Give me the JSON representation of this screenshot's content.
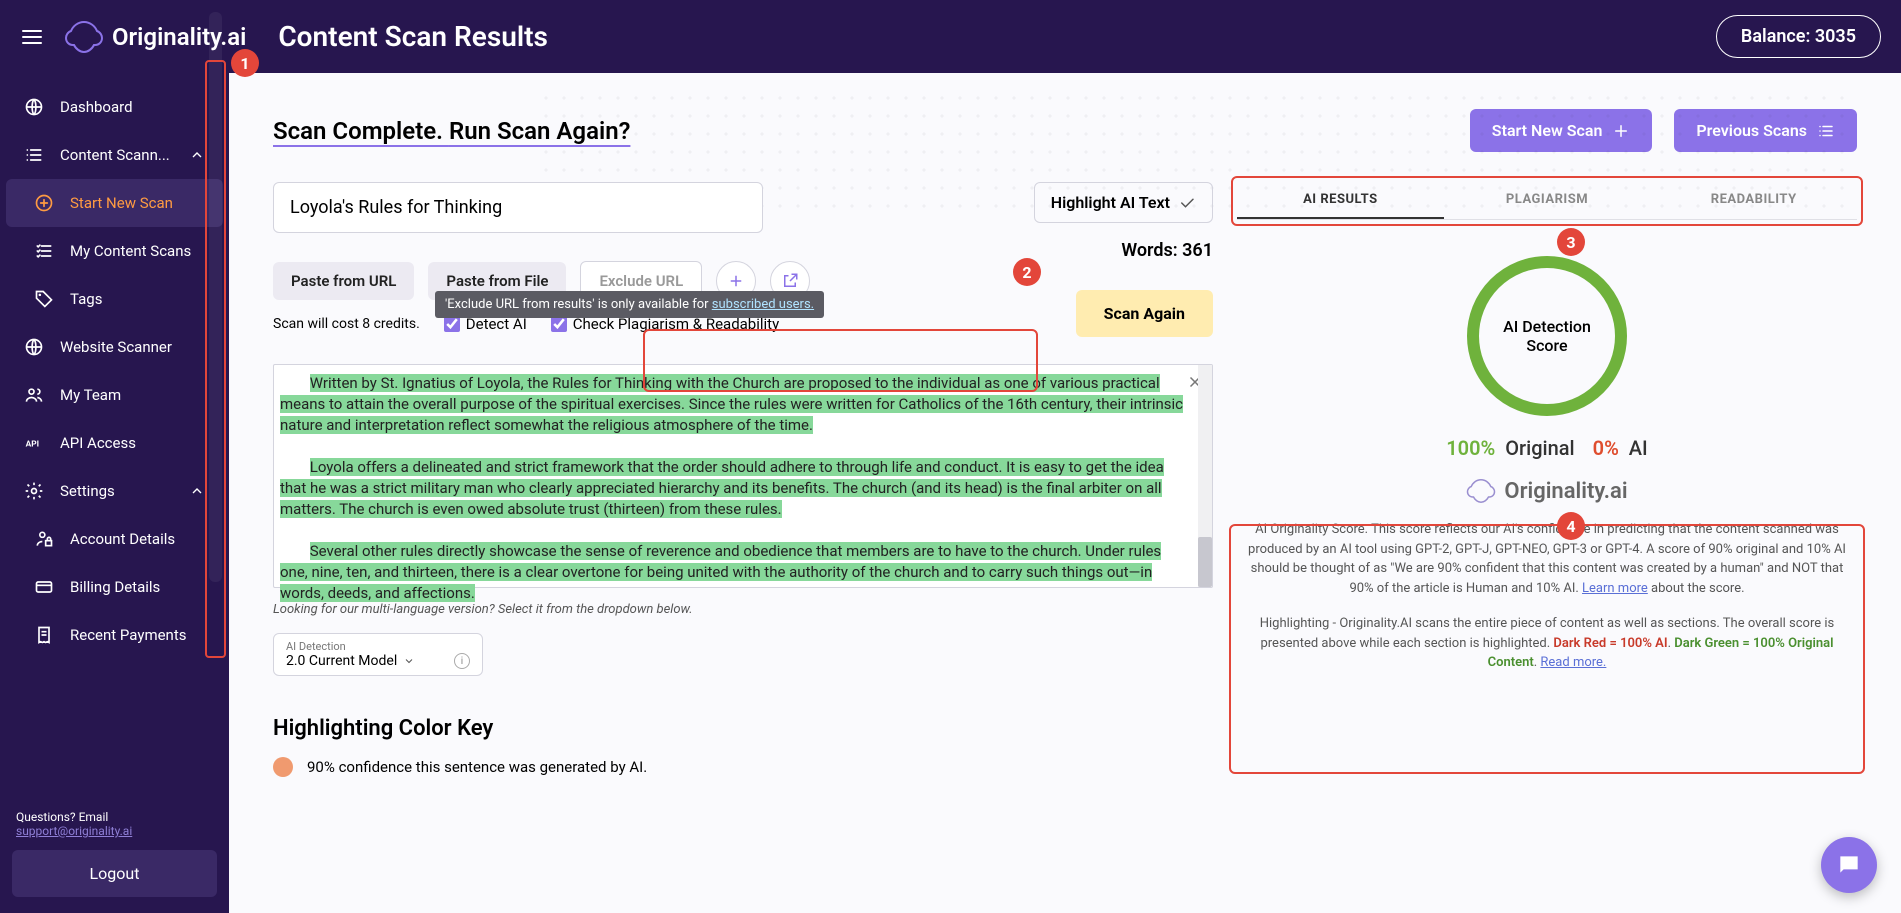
{
  "header": {
    "logo_text": "Originality.ai",
    "page_title": "Content Scan Results",
    "balance_label": "Balance: 3035"
  },
  "sidebar": {
    "items": [
      {
        "label": "Dashboard",
        "icon": "globe"
      },
      {
        "label": "Content Scann...",
        "icon": "list",
        "chevron": true
      },
      {
        "label": "Start New Scan",
        "icon": "plus-circle",
        "indented": true,
        "active": true
      },
      {
        "label": "My Content Scans",
        "icon": "list-check",
        "indented": true
      },
      {
        "label": "Tags",
        "icon": "tag",
        "indented": true
      },
      {
        "label": "Website Scanner",
        "icon": "globe"
      },
      {
        "label": "My Team",
        "icon": "users"
      },
      {
        "label": "API Access",
        "icon": "api"
      },
      {
        "label": "Settings",
        "icon": "gear",
        "chevron": true
      },
      {
        "label": "Account Details",
        "icon": "user-lock",
        "indented": true
      },
      {
        "label": "Billing Details",
        "icon": "card",
        "indented": true
      },
      {
        "label": "Recent Payments",
        "icon": "receipt",
        "indented": true
      }
    ],
    "questions_prefix": "Questions? Email ",
    "support_email": "support@originality.ai",
    "logout": "Logout"
  },
  "main": {
    "scan_complete": "Scan Complete. ",
    "run_again": "Run Scan Again?",
    "start_new_scan": "Start New Scan",
    "previous_scans": "Previous Scans",
    "title_value": "Loyola's Rules for Thinking",
    "paste_url": "Paste from URL",
    "paste_file": "Paste from File",
    "exclude_url": "Exclude URL",
    "cost_text": "Scan will cost 8 credits.",
    "detect_ai": "Detect AI",
    "check_plag": "Check Plagiarism & Readability",
    "tooltip_prefix": "'Exclude URL from results' is only available for ",
    "tooltip_link": "subscribed users.",
    "highlight_toggle": "Highlight AI Text",
    "words": "Words: 361",
    "scan_again": "Scan Again",
    "editor_p1": "Written by St. Ignatius of Loyola, the Rules for Thinking with the Church are proposed to the individual as one of various practical means to attain the overall purpose of the spiritual exercises. Since the rules were written for Catholics of the 16th century, their intrinsic nature and interpretation reflect somewhat the religious atmosphere of the time.",
    "editor_p2": "Loyola offers a delineated and strict framework that the order should adhere to through life and conduct. It is easy to get the idea that he was a strict military man who clearly appreciated hierarchy and its benefits. The church (and its head) is the final arbiter on all matters. The church is even owed absolute trust (thirteen) from these rules.",
    "editor_p3": "Several other rules directly showcase the sense of reverence and obedience that members are to have to the church. Under rules one, nine, ten, and thirteen, there is a clear overtone for being united with the authority of the church and to carry such things out—in words, deeds, and affections.",
    "hint_text": "Looking for our multi-language version? Select it from the dropdown below.",
    "model_label": "AI Detection",
    "model_value": "2.0 Current Model",
    "color_key_title": "Highlighting Color Key",
    "color_key_items": [
      {
        "color": "#f09a6f",
        "text": "90% confidence this sentence was generated by AI."
      }
    ]
  },
  "right": {
    "tabs": [
      "AI RESULTS",
      "PLAGIARISM",
      "READABILITY"
    ],
    "gauge_line1": "AI Detection",
    "gauge_line2": "Score",
    "score_original_pct": "100%",
    "score_original_label": "Original",
    "score_ai_pct": "0%",
    "score_ai_label": "AI",
    "logo_label": "Originality.ai",
    "desc1_a": "AI Originality Score. This score reflects our AI's confidence in predicting that the content scanned was produced by an AI tool using GPT-2, GPT-J, GPT-NEO, GPT-3 or GPT-4. A score of 90% original and 10% AI should be thought of as \"We are 90% confident that this content was created by a human\" and NOT that 90% of the article is Human and 10% AI. ",
    "learn_more": "Learn more",
    "desc1_b": " about the score.",
    "desc2_a": "Highlighting - Originality.AI scans the entire piece of content as well as sections. The overall score is presented above while each section is highlighted. ",
    "dark_red": "Dark Red = 100% AI",
    "desc2_mid": ". ",
    "dark_green": "Dark Green = 100% Original Content",
    "desc2_b": ". ",
    "read_more": "Read more."
  },
  "annotations": {
    "a1": "1",
    "a2": "2",
    "a3": "3",
    "a4": "4"
  }
}
